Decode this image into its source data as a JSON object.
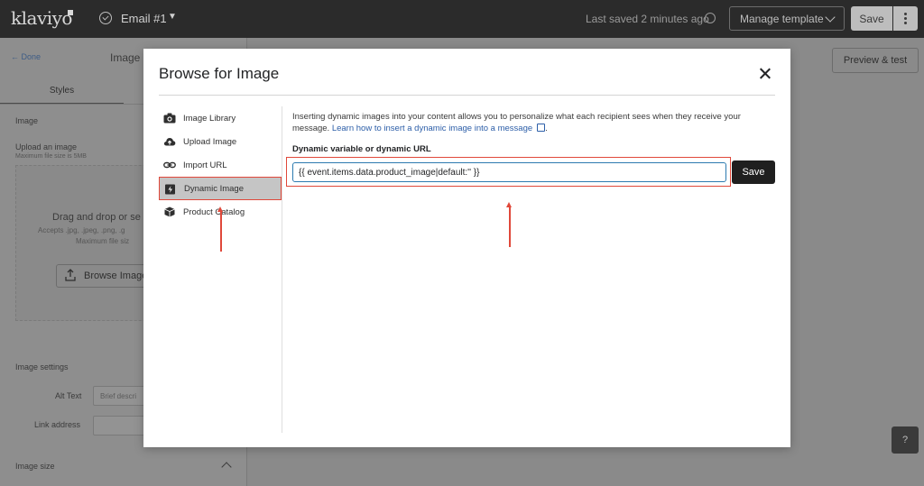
{
  "topbar": {
    "logo": "klaviyo",
    "email_name": "Email #1",
    "last_saved": "Last saved 2 minutes ago",
    "manage_template": "Manage template",
    "save": "Save"
  },
  "left_panel": {
    "done": "Done",
    "title": "Image",
    "tab_styles": "Styles",
    "section_image": "Image",
    "upload_label": "Upload an image",
    "upload_sub": "Maximum file size is 5MB",
    "drag_text": "Drag and drop or se",
    "accepts_text": "Accepts .jpg, .jpeg, .png, .g",
    "maxfile_text": "Maximum file siz",
    "browse_button": "Browse Image",
    "image_settings": "Image settings",
    "alt_text_label": "Alt Text",
    "alt_text_placeholder": "Brief descri",
    "link_address_label": "Link address",
    "image_size": "Image size"
  },
  "right_area": {
    "preview_test": "Preview & test",
    "help": "?"
  },
  "modal": {
    "title": "Browse for Image",
    "nav": [
      {
        "label": "Image Library",
        "icon": "camera-icon"
      },
      {
        "label": "Upload Image",
        "icon": "cloud-upload-icon"
      },
      {
        "label": "Import URL",
        "icon": "link-icon"
      },
      {
        "label": "Dynamic Image",
        "icon": "dynamic-image-icon"
      },
      {
        "label": "Product Catalog",
        "icon": "box-icon"
      }
    ],
    "active_nav": "Dynamic Image",
    "description": "Inserting dynamic images into your content allows you to personalize what each recipient sees when they receive your message.",
    "learn_link": "Learn how to insert a dynamic image into a message",
    "field_label": "Dynamic variable or dynamic URL",
    "field_value": "{{ event.items.data.product_image|default:'' }}",
    "save_button": "Save"
  },
  "colors": {
    "highlight": "#e0483a",
    "link": "#2c5ea8",
    "save_button": "#1f1f1f",
    "topbar": "#2b2b2b"
  }
}
